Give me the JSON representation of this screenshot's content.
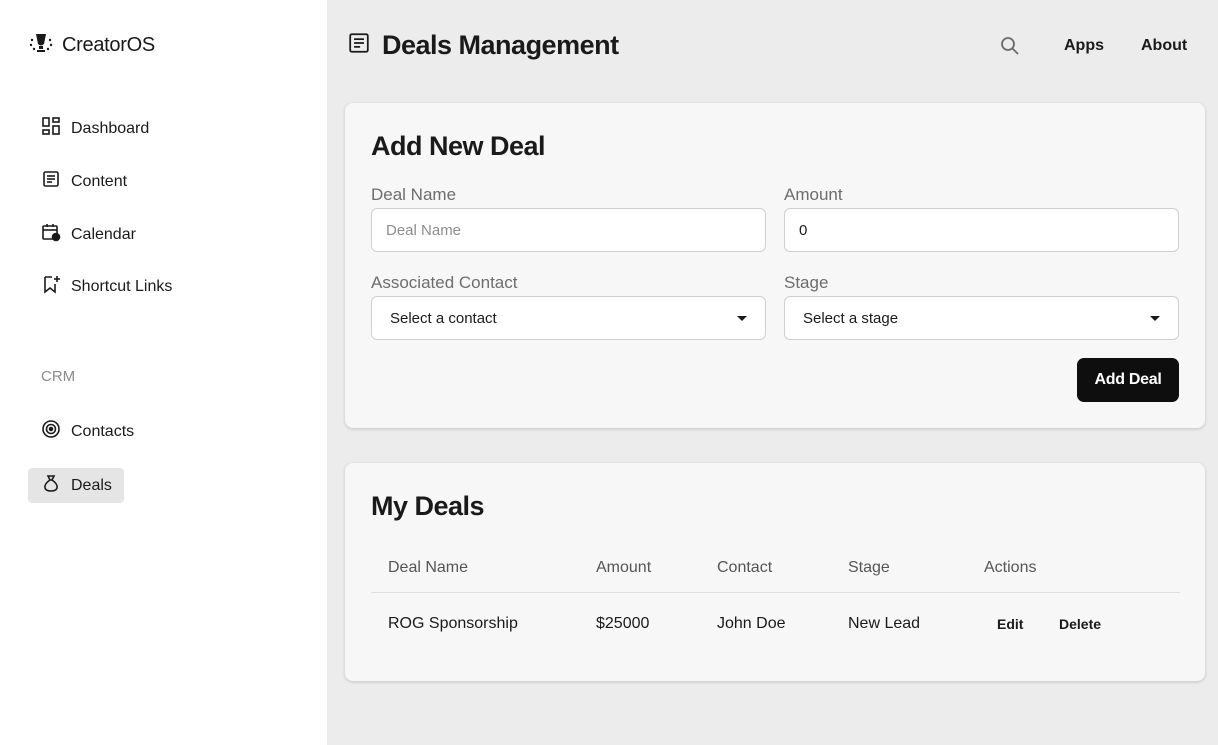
{
  "app": {
    "name": "CreatorOS",
    "logo_icon": "logo-icon"
  },
  "sidebar": {
    "items": [
      {
        "label": "Dashboard",
        "icon": "dashboard-icon"
      },
      {
        "label": "Content",
        "icon": "document-icon"
      },
      {
        "label": "Calendar",
        "icon": "calendar-icon"
      },
      {
        "label": "Shortcut Links",
        "icon": "bookmark-add-icon"
      }
    ],
    "crm_label": "CRM",
    "crm_items": [
      {
        "label": "Contacts",
        "icon": "target-icon"
      },
      {
        "label": "Deals",
        "icon": "money-bag-icon",
        "active": true
      }
    ]
  },
  "header": {
    "title": "Deals Management",
    "title_icon": "document-icon",
    "nav": {
      "search_icon": "search-icon",
      "apps_label": "Apps",
      "about_label": "About"
    }
  },
  "add_deal": {
    "title": "Add New Deal",
    "deal_name_label": "Deal Name",
    "deal_name_placeholder": "Deal Name",
    "amount_label": "Amount",
    "amount_value": "0",
    "contact_label": "Associated Contact",
    "contact_value": "Select a contact",
    "stage_label": "Stage",
    "stage_value": "Select a stage",
    "submit_label": "Add Deal"
  },
  "my_deals": {
    "title": "My Deals",
    "columns": [
      "Deal Name",
      "Amount",
      "Contact",
      "Stage",
      "Actions"
    ],
    "rows": [
      {
        "deal_name": "ROG Sponsorship",
        "amount": "$25000",
        "contact": "John Doe",
        "stage": "New Lead",
        "edit_label": "Edit",
        "delete_label": "Delete"
      }
    ]
  },
  "colors": {
    "sidebar_bg": "#ffffff",
    "main_bg": "#ececec",
    "card_bg": "#f7f7f7",
    "primary_button": "#0e0e0e",
    "active_nav_bg": "#e5e5e5"
  }
}
